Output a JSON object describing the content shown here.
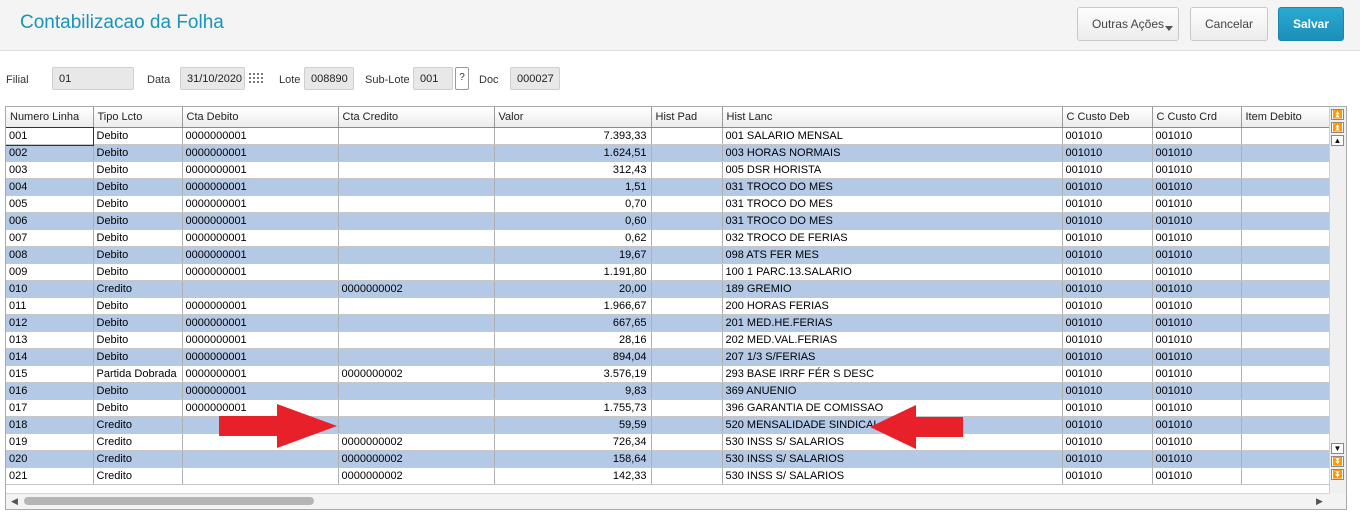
{
  "header": {
    "title": "Contabilizacao da Folha",
    "buttons": {
      "outras": "Outras Ações",
      "cancelar": "Cancelar",
      "salvar": "Salvar"
    }
  },
  "form": {
    "filial": {
      "label": "Filial",
      "value": "01"
    },
    "data": {
      "label": "Data",
      "value": "31/10/2020"
    },
    "lote": {
      "label": "Lote",
      "value": "008890"
    },
    "sublote": {
      "label": "Sub-Lote",
      "value": "001",
      "help": "?"
    },
    "doc": {
      "label": "Doc",
      "value": "000027"
    }
  },
  "grid": {
    "columns": [
      "Numero Linha",
      "Tipo Lcto",
      "Cta Debito",
      "Cta Credito",
      "Valor",
      "Hist Pad",
      "Hist Lanc",
      "C Custo Deb",
      "C Custo Crd",
      "Item Debito"
    ],
    "rows": [
      [
        "001",
        "Debito",
        "0000000001",
        "",
        "7.393,33",
        "",
        "001 SALARIO MENSAL",
        "001010",
        "001010",
        ""
      ],
      [
        "002",
        "Debito",
        "0000000001",
        "",
        "1.624,51",
        "",
        "003 HORAS NORMAIS",
        "001010",
        "001010",
        ""
      ],
      [
        "003",
        "Debito",
        "0000000001",
        "",
        "312,43",
        "",
        "005 DSR HORISTA",
        "001010",
        "001010",
        ""
      ],
      [
        "004",
        "Debito",
        "0000000001",
        "",
        "1,51",
        "",
        "031 TROCO DO MES",
        "001010",
        "001010",
        ""
      ],
      [
        "005",
        "Debito",
        "0000000001",
        "",
        "0,70",
        "",
        "031 TROCO DO MES",
        "001010",
        "001010",
        ""
      ],
      [
        "006",
        "Debito",
        "0000000001",
        "",
        "0,60",
        "",
        "031 TROCO DO MES",
        "001010",
        "001010",
        ""
      ],
      [
        "007",
        "Debito",
        "0000000001",
        "",
        "0,62",
        "",
        "032 TROCO DE FERIAS",
        "001010",
        "001010",
        ""
      ],
      [
        "008",
        "Debito",
        "0000000001",
        "",
        "19,67",
        "",
        "098 ATS FER MES",
        "001010",
        "001010",
        ""
      ],
      [
        "009",
        "Debito",
        "0000000001",
        "",
        "1.191,80",
        "",
        "100 1 PARC.13.SALARIO",
        "001010",
        "001010",
        ""
      ],
      [
        "010",
        "Credito",
        "",
        "0000000002",
        "20,00",
        "",
        "189 GREMIO",
        "001010",
        "001010",
        ""
      ],
      [
        "011",
        "Debito",
        "0000000001",
        "",
        "1.966,67",
        "",
        "200 HORAS FERIAS",
        "001010",
        "001010",
        ""
      ],
      [
        "012",
        "Debito",
        "0000000001",
        "",
        "667,65",
        "",
        "201 MED.HE.FERIAS",
        "001010",
        "001010",
        ""
      ],
      [
        "013",
        "Debito",
        "0000000001",
        "",
        "28,16",
        "",
        "202 MED.VAL.FERIAS",
        "001010",
        "001010",
        ""
      ],
      [
        "014",
        "Debito",
        "0000000001",
        "",
        "894,04",
        "",
        "207 1/3 S/FERIAS",
        "001010",
        "001010",
        ""
      ],
      [
        "015",
        "Partida Dobrada",
        "0000000001",
        "0000000002",
        "3.576,19",
        "",
        "293 BASE IRRF FÉR S DESC",
        "001010",
        "001010",
        ""
      ],
      [
        "016",
        "Debito",
        "0000000001",
        "",
        "9,83",
        "",
        "369 ANUENIO",
        "001010",
        "001010",
        ""
      ],
      [
        "017",
        "Debito",
        "0000000001",
        "",
        "1.755,73",
        "",
        "396 GARANTIA DE COMISSAO",
        "001010",
        "001010",
        ""
      ],
      [
        "018",
        "Credito",
        "",
        "",
        "59,59",
        "",
        "520 MENSALIDADE SINDICAL",
        "001010",
        "001010",
        ""
      ],
      [
        "019",
        "Credito",
        "",
        "0000000002",
        "726,34",
        "",
        "530 INSS S/ SALARIOS",
        "001010",
        "001010",
        ""
      ],
      [
        "020",
        "Credito",
        "",
        "0000000002",
        "158,64",
        "",
        "530 INSS S/ SALARIOS",
        "001010",
        "001010",
        ""
      ],
      [
        "021",
        "Credito",
        "",
        "0000000002",
        "142,33",
        "",
        "530 INSS S/ SALARIOS",
        "001010",
        "001010",
        ""
      ]
    ]
  },
  "colors": {
    "accent": "#1a94b8",
    "row_alt": "#b3c9e6",
    "arrow": "#e8202a"
  },
  "annotations": {
    "arrows": [
      "arrow-right",
      "arrow-left"
    ]
  }
}
